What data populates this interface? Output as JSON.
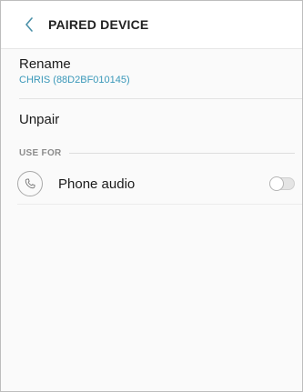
{
  "header": {
    "back_icon": "chevron-left-icon",
    "title": "PAIRED DEVICE"
  },
  "rename": {
    "label": "Rename",
    "device_name": "CHRIS (88D2BF010145)"
  },
  "unpair": {
    "label": "Unpair"
  },
  "use_for": {
    "section_title": "USE FOR",
    "items": [
      {
        "icon": "phone-icon",
        "label": "Phone audio",
        "enabled": false
      }
    ]
  },
  "colors": {
    "accent": "#3a98b9",
    "back_icon": "#4a90a8",
    "background": "#fafafa"
  }
}
